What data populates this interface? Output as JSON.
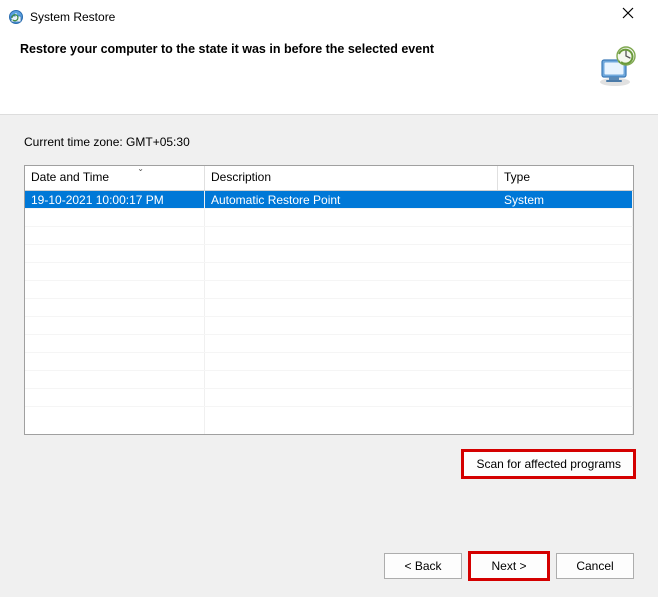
{
  "window": {
    "title": "System Restore"
  },
  "header": {
    "headline": "Restore your computer to the state it was in before the selected event"
  },
  "content": {
    "timezone_label": "Current time zone: GMT+05:30",
    "columns": {
      "date": "Date and Time",
      "desc": "Description",
      "type": "Type"
    },
    "rows": [
      {
        "date": "19-10-2021 10:00:17 PM",
        "desc": "Automatic Restore Point",
        "type": "System"
      }
    ],
    "scan_button": "Scan for affected programs"
  },
  "footer": {
    "back": "< Back",
    "next": "Next >",
    "cancel": "Cancel"
  }
}
